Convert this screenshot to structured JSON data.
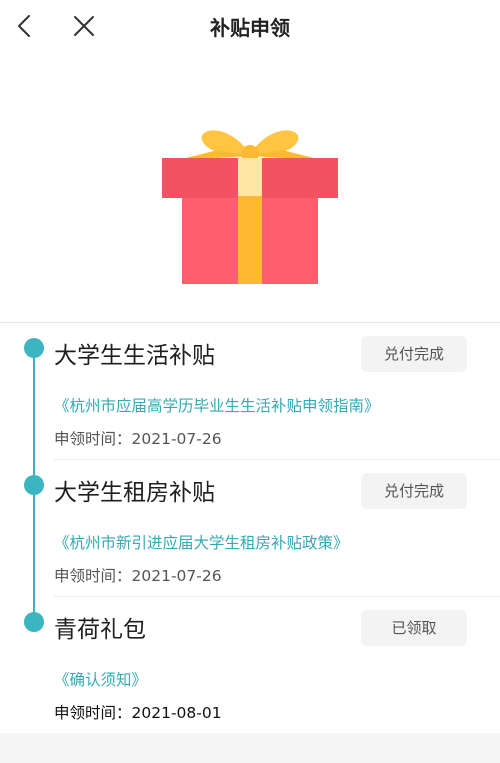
{
  "header": {
    "title": "补贴申领",
    "back_icon": "chevron-left-icon",
    "close_icon": "close-icon"
  },
  "hero": {
    "icon": "gift-icon",
    "colors": {
      "box": "#ff5f6d",
      "box_lid": "#f25262",
      "ribbon": "#ffb832",
      "ribbon_light": "#ffe6a6",
      "bow": "#ffc440"
    }
  },
  "timeline": {
    "accent_color": "#3bb5c0",
    "items": [
      {
        "title": "大学生生活补贴",
        "status": "兑付完成",
        "link": "《杭州市应届高学历毕业生生活补贴申领指南》",
        "time": "申领时间：2021-07-26"
      },
      {
        "title": "大学生租房补贴",
        "status": "兑付完成",
        "link": "《杭州市新引进应届大学生租房补贴政策》",
        "time": "申领时间：2021-07-26"
      },
      {
        "title": "青荷礼包",
        "status": "已领取",
        "link": "《确认须知》",
        "time": "申领时间：2021-08-01"
      }
    ]
  }
}
